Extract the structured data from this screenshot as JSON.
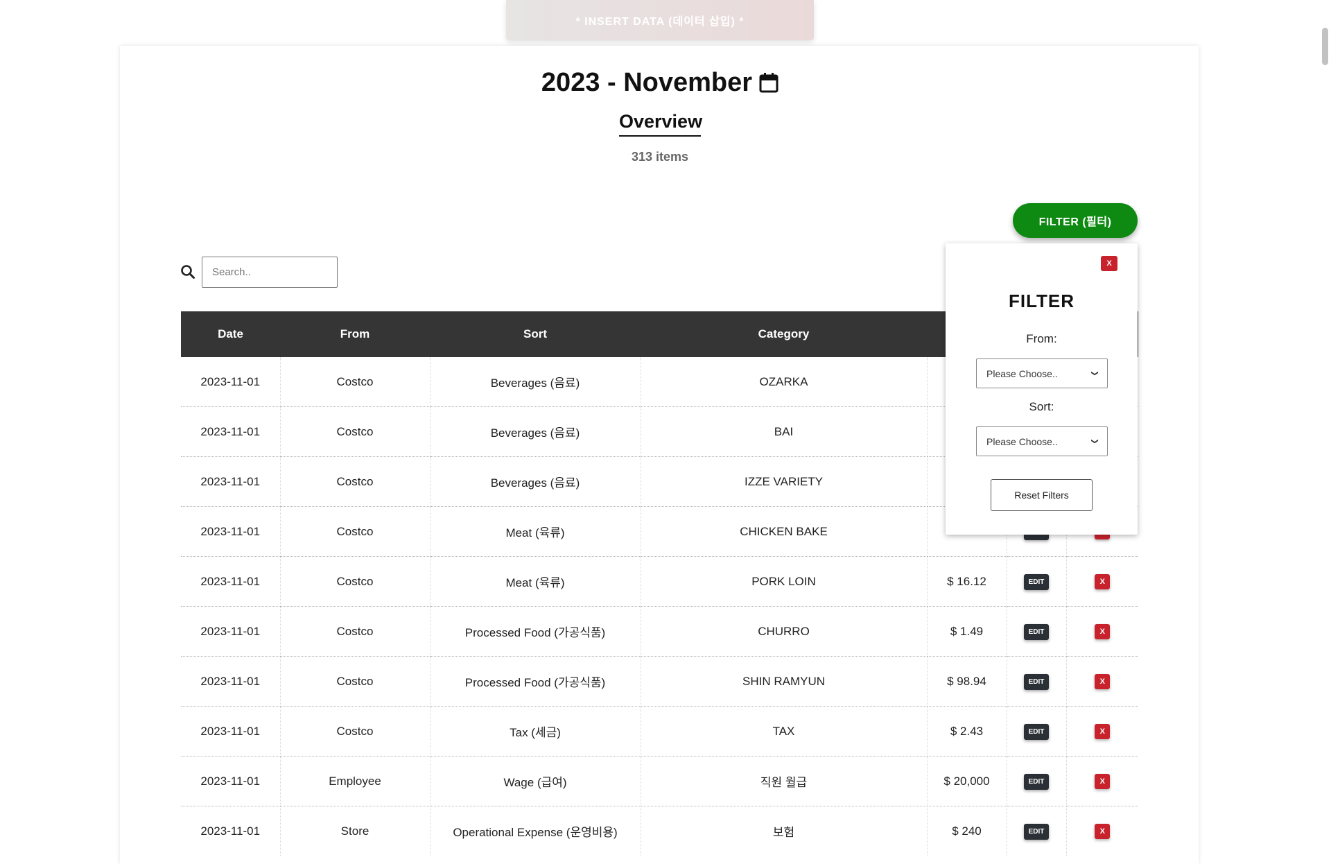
{
  "header": {
    "insert_button": "* INSERT DATA (데이터 삽입) *",
    "title": "2023 - November",
    "subtitle": "Overview",
    "item_count": "313 items",
    "filter_button": "FILTER (필터)"
  },
  "search": {
    "placeholder": "Search.."
  },
  "table": {
    "columns": [
      "Date",
      "From",
      "Sort",
      "Category"
    ],
    "rows": [
      {
        "date": "2023-11-01",
        "from": "Costco",
        "sort": "Beverages (음료)",
        "category": "OZARKA",
        "amount": ""
      },
      {
        "date": "2023-11-01",
        "from": "Costco",
        "sort": "Beverages (음료)",
        "category": "BAI",
        "amount": ""
      },
      {
        "date": "2023-11-01",
        "from": "Costco",
        "sort": "Beverages (음료)",
        "category": "IZZE VARIETY",
        "amount": ""
      },
      {
        "date": "2023-11-01",
        "from": "Costco",
        "sort": "Meat (육류)",
        "category": "CHICKEN BAKE",
        "amount": ""
      },
      {
        "date": "2023-11-01",
        "from": "Costco",
        "sort": "Meat (육류)",
        "category": "PORK LOIN",
        "amount": "$ 16.12"
      },
      {
        "date": "2023-11-01",
        "from": "Costco",
        "sort": "Processed Food (가공식품)",
        "category": "CHURRO",
        "amount": "$ 1.49"
      },
      {
        "date": "2023-11-01",
        "from": "Costco",
        "sort": "Processed Food (가공식품)",
        "category": "SHIN RAMYUN",
        "amount": "$ 98.94"
      },
      {
        "date": "2023-11-01",
        "from": "Costco",
        "sort": "Tax (세금)",
        "category": "TAX",
        "amount": "$ 2.43"
      },
      {
        "date": "2023-11-01",
        "from": "Employee",
        "sort": "Wage (급여)",
        "category": "직원 월급",
        "amount": "$ 20,000"
      },
      {
        "date": "2023-11-01",
        "from": "Store",
        "sort": "Operational Expense (운영비용)",
        "category": "보험",
        "amount": "$ 240"
      }
    ],
    "edit_label": "EDIT",
    "delete_label": "X"
  },
  "filter_panel": {
    "close_label": "X",
    "title": "FILTER",
    "from_label": "From:",
    "from_value": "Please Choose..",
    "sort_label": "Sort:",
    "sort_value": "Please Choose..",
    "reset_label": "Reset Filters"
  },
  "colors": {
    "filter_button": "#0e8a12",
    "table_header": "#353535",
    "delete_button": "#c8232c",
    "edit_button": "#2b3036"
  }
}
